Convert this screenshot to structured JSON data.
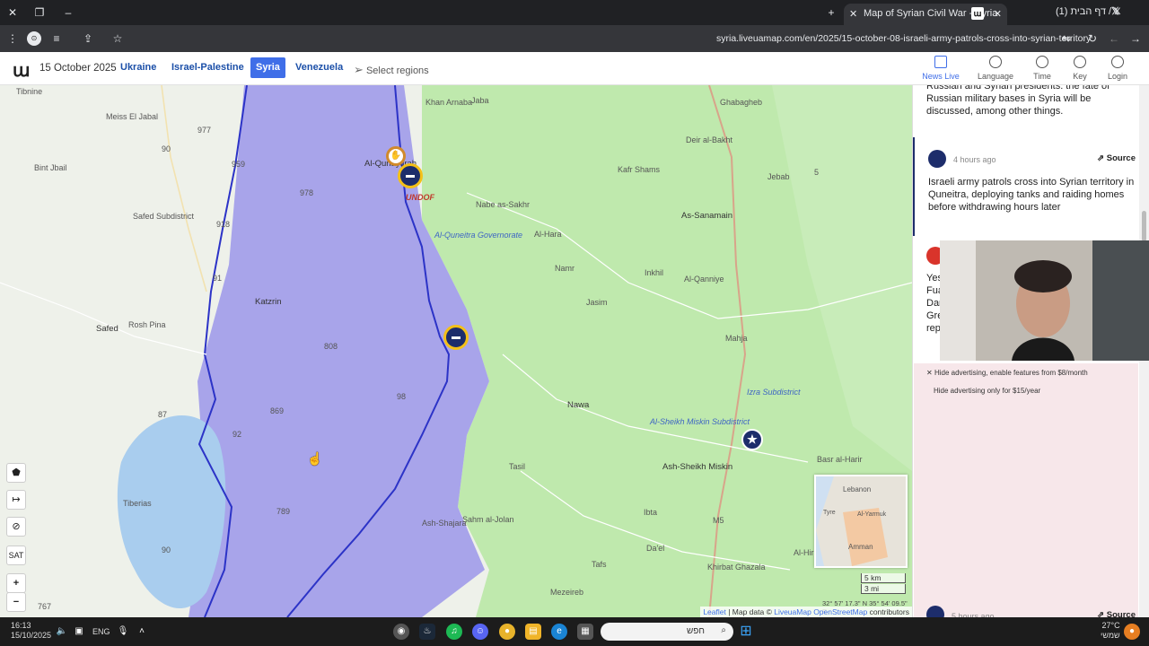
{
  "browser": {
    "tab_active_title": "Map of Syrian Civil War - Syria",
    "tab_2_title": "(1) דף הבית / X",
    "url": "syria.liveuamap.com/en/2025/15-october-08-israeli-army-patrols-cross-into-syrian-territory"
  },
  "header": {
    "logo": "ա",
    "date": "15 October 2025",
    "regions": [
      "Ukraine",
      "Israel-Palestine",
      "Syria",
      "Venezuela"
    ],
    "active_region": "Syria",
    "select_regions": "Select regions",
    "icons": [
      "News Live",
      "Language",
      "Time",
      "Key",
      "Login"
    ]
  },
  "map": {
    "places": {
      "tibnine": "Tibnine",
      "meiss": "Meiss El Jabal",
      "bintjbail": "Bint Jbail",
      "safed_sub": "Safed Subdistrict",
      "safed": "Safed",
      "roshpina": "Rosh Pina",
      "tiberias": "Tiberias",
      "katzrin": "Katzrin",
      "alqunaytirah": "Al-Qunaytirah",
      "undof": "UNDOF",
      "quneitra_gov": "Al-Quneitra Governorate",
      "khanarnaba": "Khan Arnaba",
      "jaba": "Jaba",
      "nabeassakhr": "Nabe as-Sakhr",
      "alhara": "Al-Hara",
      "namr": "Namr",
      "jasim": "Jasim",
      "inkhil": "Inkhil",
      "alqanniye": "Al-Qanniye",
      "kafrshams": "Kafr Shams",
      "deiralbakht": "Deir al-Bakht",
      "ghabagheb": "Ghabagheb",
      "jebab": "Jebab",
      "assanamain": "As-Sanamain",
      "mahja": "Mahja",
      "izra_sub": "Izra Subdistrict",
      "nawa": "Nawa",
      "alsheikh_sub": "Al-Sheikh Miskin Subdistrict",
      "ashsheikhmiskin": "Ash-Sheikh Miskin",
      "tasil": "Tasil",
      "sahmaljolan": "Sahm al-Jolan",
      "ashshajara": "Ash-Shajara",
      "ibta": "Ibta",
      "dael": "Da'el",
      "tafs": "Tafs",
      "khirbatghazala": "Khirbat Ghazala",
      "mezeireb": "Mezeireb",
      "basralharir": "Basr al-Harir",
      "alhirak": "Al-Hirak"
    },
    "roads": [
      "977",
      "90",
      "959",
      "978",
      "918",
      "91",
      "808",
      "98",
      "869",
      "92",
      "87",
      "789",
      "90",
      "767",
      "5",
      "M5"
    ],
    "minimap_labels": [
      "Lebanon",
      "Tyre",
      "Al-Yarmuk",
      "Amman"
    ],
    "scale_km": "5 km",
    "scale_mi": "3 mi",
    "coords": "32° 57' 17.3\" N 35° 54' 09.5\" E",
    "attribution": {
      "leaflet": "Leaflet",
      "map_data": " | Map data © ",
      "lua": "LiveuaMap",
      "osm": "OpenStreetMap",
      "contributors": "contributors"
    },
    "controls": [
      "SAT",
      "+",
      "−"
    ]
  },
  "panel": {
    "news_top_text": "Russian military bases in Syria will be discussed, among other things.",
    "news_top_partial": "Russian and Syrian presidents: the fate of",
    "news_1_time": "4 hours ago",
    "news_1_source": "Source",
    "news_1_text": "Israeli army patrols cross into Syrian territory in Quneitra, deploying tanks and raiding homes before withdrawing hours later",
    "news_2_partial": [
      "Yes",
      "Fua",
      "Dar",
      "Gre",
      "repo"
    ],
    "ad_1": "Hide advertising, enable features from $8/month",
    "ad_2": "Hide advertising only for $15/year",
    "news_3_time": "5 hours ago",
    "news_3_source": "Source"
  },
  "taskbar": {
    "time": "16:13",
    "date": "15/10/2025",
    "lang": "ENG",
    "search_text": "חפש",
    "temp": "27°C",
    "weather": "שמשי"
  }
}
